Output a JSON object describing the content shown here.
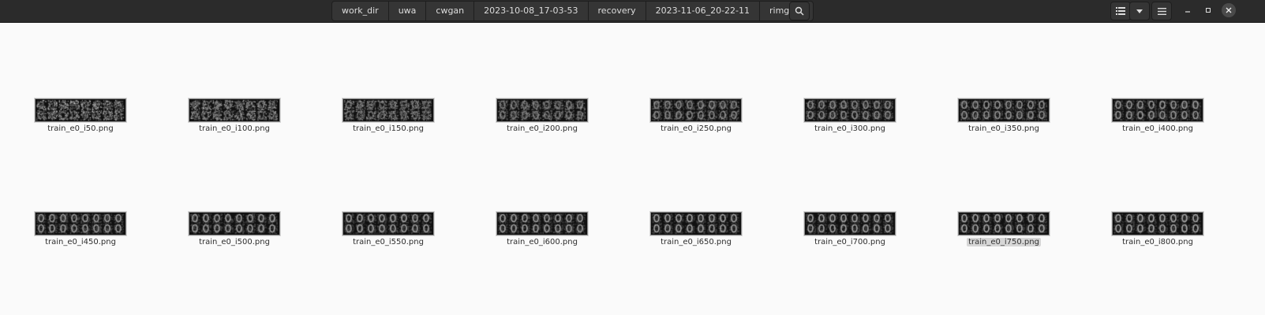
{
  "path_bar": {
    "segments": [
      "work_dir",
      "uwa",
      "cwgan",
      "2023-10-08_17-03-53",
      "recovery",
      "2023-11-06_20-22-11",
      "rimg"
    ]
  },
  "toolbar": {
    "search_icon": "search-icon",
    "view_icon": "list-view-icon",
    "view_options_icon": "chevron-down-icon",
    "menu_icon": "hamburger-menu-icon"
  },
  "window": {
    "minimize_icon": "minimize-icon",
    "maximize_icon": "maximize-icon",
    "close_icon": "close-icon"
  },
  "colors": {
    "headerbar": "#2b2b2b",
    "background": "#fafafa",
    "selected": "#d6d6d6"
  },
  "files": [
    {
      "name": "train_e0_i50.png",
      "noise": 0.9
    },
    {
      "name": "train_e0_i100.png",
      "noise": 0.8
    },
    {
      "name": "train_e0_i150.png",
      "noise": 0.65
    },
    {
      "name": "train_e0_i200.png",
      "noise": 0.5
    },
    {
      "name": "train_e0_i250.png",
      "noise": 0.35
    },
    {
      "name": "train_e0_i300.png",
      "noise": 0.3
    },
    {
      "name": "train_e0_i350.png",
      "noise": 0.25
    },
    {
      "name": "train_e0_i400.png",
      "noise": 0.2
    },
    {
      "name": "train_e0_i450.png",
      "noise": 0.2
    },
    {
      "name": "train_e0_i500.png",
      "noise": 0.18
    },
    {
      "name": "train_e0_i550.png",
      "noise": 0.15
    },
    {
      "name": "train_e0_i600.png",
      "noise": 0.15
    },
    {
      "name": "train_e0_i650.png",
      "noise": 0.12
    },
    {
      "name": "train_e0_i700.png",
      "noise": 0.12
    },
    {
      "name": "train_e0_i750.png",
      "noise": 0.1,
      "selected": true
    },
    {
      "name": "train_e0_i800.png",
      "noise": 0.1
    }
  ]
}
